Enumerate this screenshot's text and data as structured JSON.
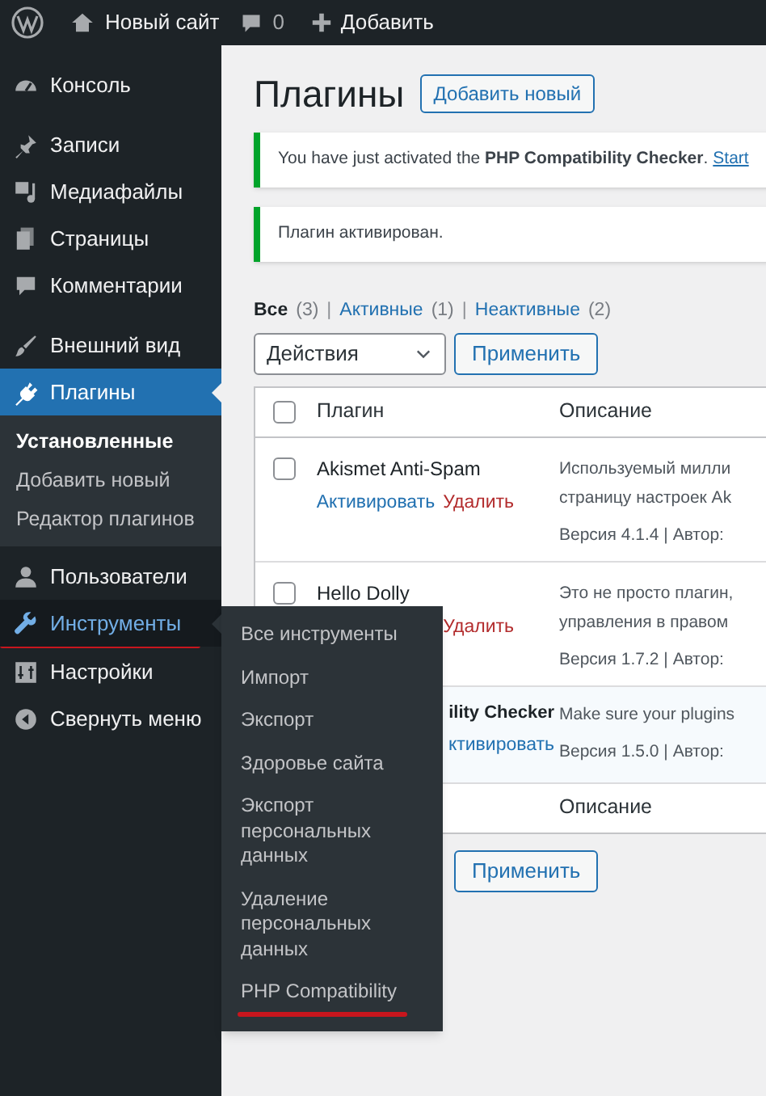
{
  "admin_bar": {
    "site_name": "Новый сайт",
    "comments_count": "0",
    "new_label": "Добавить"
  },
  "sidebar": {
    "items": [
      {
        "label": "Консоль",
        "selected": false,
        "hover": false
      },
      {
        "label": "Записи",
        "selected": false,
        "hover": false
      },
      {
        "label": "Медиафайлы",
        "selected": false,
        "hover": false
      },
      {
        "label": "Страницы",
        "selected": false,
        "hover": false
      },
      {
        "label": "Комментарии",
        "selected": false,
        "hover": false
      },
      {
        "label": "Внешний вид",
        "selected": false,
        "hover": false
      },
      {
        "label": "Плагины",
        "selected": true,
        "hover": false,
        "children": [
          {
            "label": "Установленные",
            "selected": true
          },
          {
            "label": "Добавить новый",
            "selected": false
          },
          {
            "label": "Редактор плагинов",
            "selected": false
          }
        ]
      },
      {
        "label": "Пользователи",
        "selected": false,
        "hover": false
      },
      {
        "label": "Инструменты",
        "selected": false,
        "hover": true
      },
      {
        "label": "Настройки",
        "selected": false,
        "hover": false
      },
      {
        "label": "Свернуть меню",
        "selected": false,
        "hover": false
      }
    ]
  },
  "flyout_menu": {
    "items": [
      {
        "label": "Все инструменты"
      },
      {
        "label": "Импорт"
      },
      {
        "label": "Экспорт"
      },
      {
        "label": "Здоровье сайта"
      },
      {
        "label": "Экспорт персональных данных"
      },
      {
        "label": "Удаление персональных данных"
      },
      {
        "label": "PHP Compatibility",
        "underlined": true
      }
    ]
  },
  "page": {
    "title": "Плагины",
    "add_new": "Добавить новый",
    "notices": [
      {
        "text": "You have just activated the **PHP Compatibility Checker**.",
        "link": "Start"
      },
      {
        "text": "Плагин активирован."
      }
    ],
    "filters": [
      {
        "label": "Все",
        "count": "(3)",
        "selected": true
      },
      {
        "separator": "|",
        "label": "Активные",
        "count": "(1)",
        "selected": false
      },
      {
        "separator": "|",
        "label": "Неактивные",
        "count": "(2)",
        "selected": false
      }
    ],
    "bulk_select": "Действия",
    "apply": "Применить",
    "bottom_apply": "Применить",
    "table": {
      "columns": [
        "Плагин",
        "Описание"
      ],
      "select_all_checked": false,
      "footer_column": "Описание",
      "rows": [
        {
          "kind": "inactive",
          "checked": false,
          "name": "Akismet Anti-Spam",
          "actions": [
            {
              "label": "Активировать",
              "kind": "activate"
            },
            {
              "label": "Удалить",
              "kind": "delete"
            }
          ],
          "description": [
            "Используемый милли",
            "страницу настроек Ak"
          ],
          "meta": "Версия 4.1.4 | Автор:"
        },
        {
          "kind": "inactive",
          "checked": false,
          "name": "Hello Dolly",
          "actions": [
            {
              "label": "Удалить",
              "kind": "delete"
            }
          ],
          "description": [
            "Это не просто плагин,",
            "управления в правом"
          ],
          "meta": "Версия 1.7.2 | Автор:"
        },
        {
          "kind": "active",
          "name": "ility Checker",
          "actions": [
            {
              "label": "ктивировать",
              "kind": "activate"
            }
          ],
          "description": [
            "Make sure your plugins"
          ],
          "meta": "Версия 1.5.0 | Автор:"
        }
      ]
    }
  }
}
